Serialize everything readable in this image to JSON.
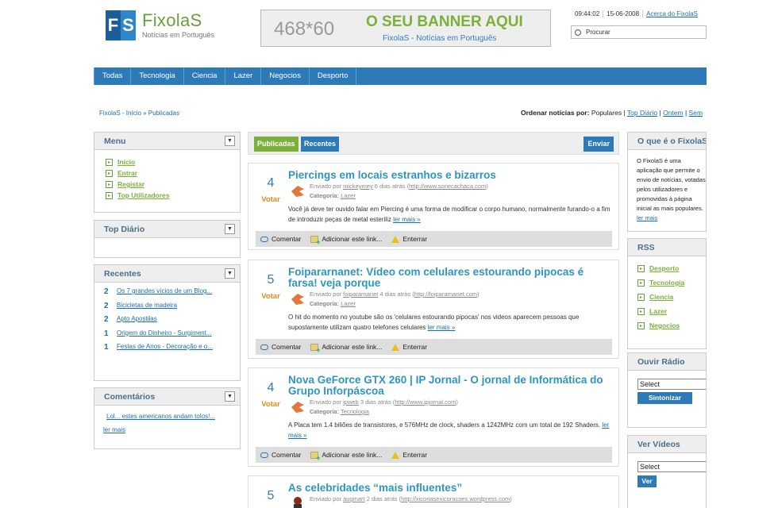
{
  "header": {
    "logo_mark": [
      "F",
      "S"
    ],
    "logo_name": "FixolaS",
    "logo_sub": "Notícias em Português",
    "banner_dim": "468*60",
    "banner_title": "O SEU BANNER AQUI",
    "banner_sub": "FixolaS - Notícias em Português",
    "time": "09:44:02",
    "date": "15-06-2008",
    "about_link": "Acerca do FixolaS",
    "search_placeholder": "Procurar"
  },
  "nav": [
    "Todas",
    "Tecnologia",
    "Ciencia",
    "Lazer",
    "Negocios",
    "Desporto"
  ],
  "breadcrumb": "FixolaS - Início » Publicadas",
  "order": {
    "label": "Ordenar notícias por:",
    "current": "Populares",
    "options": [
      "Top Diário",
      "Ontem",
      "Sem"
    ]
  },
  "left": {
    "menu": {
      "title": "Menu",
      "items": [
        "Início",
        "Entrar",
        "Registar",
        "Top Utilizadores"
      ]
    },
    "top_diario": {
      "title": "Top Diário"
    },
    "recentes": {
      "title": "Recentes",
      "items": [
        {
          "n": "2",
          "t": "Os 7 grandes vícios de um Blog..."
        },
        {
          "n": "2",
          "t": "Bicicletas de madeira"
        },
        {
          "n": "2",
          "t": "Apto Apostilas"
        },
        {
          "n": "1",
          "t": "Origem do Dinheiro - Surgiment..."
        },
        {
          "n": "1",
          "t": "Festas de Anos - Decoração e o..."
        }
      ]
    },
    "comentarios": {
      "title": "Comentários",
      "item": "Lol... estes americanos andam tolos!...",
      "more": "ler mais"
    }
  },
  "center": {
    "tabs": {
      "pub": "Publicadas",
      "rec": "Recentes",
      "send": "Enviar"
    },
    "vote_label": "Votar",
    "actions": [
      "Comentar",
      "Adicionar este link...",
      "Enterrar"
    ],
    "posts": [
      {
        "count": "4",
        "title": "Piercings em locais estranhos e bizarros",
        "meta1": "Enviado por",
        "user": "mickeymey",
        "ago": "6 dias atrás",
        "url": "http://www.sonecachaca.com",
        "cat_label": "Categoria:",
        "cat": "Lazer",
        "desc": "Você já deve ter ouvido falar em Piercing é uma forma de modificar o corpo humano, normalmente furando-o a fim de introduzir peças de metal esteriliz",
        "more": "ler mais »"
      },
      {
        "count": "5",
        "title": "Foipararnanet: Vídeo com celulares estourando pipocas é farsa! veja porque",
        "meta1": "Enviado por",
        "user": "foipararnanet",
        "ago": "4 dias atrás",
        "url": "http://foipararnanet.com",
        "cat_label": "Categoria:",
        "cat": "Lazer",
        "desc": "O hit do momento no youtube são os 'celulares estourando pipocas' nos videos aparecem pessoas que supostamente utilizam quatro telefones celulares",
        "more": "ler mais »"
      },
      {
        "count": "4",
        "title": "Nova GeForce GTX 260 | IP Jornal - O jornal de Informática do Grupo Inforpáscoa",
        "meta1": "Enviado por",
        "user": "ipweb",
        "ago": "3 dias atrás",
        "url": "http://www.ipjornal.com",
        "cat_label": "Categoria:",
        "cat": "Tecnologia",
        "desc": "A Placa tem 1.4 biliões de transistores, e 576MHz de clock, shaders a 1242MHz com um total de 192 Shaders.",
        "more": "ler mais »"
      },
      {
        "count": "5",
        "title": "As celebridades “mais influentes”",
        "meta1": "Enviado por",
        "user": "augmart",
        "ago": "2 dias atrás",
        "url": "http://xicoriasexicoracoes.wordpress.com"
      }
    ]
  },
  "right": {
    "about": {
      "title": "O que é o FixolaS",
      "text": "O FixolaS é uma aplicação que permite o envio de notícias, votadas pelos utilizadores e promovidas à página inicial as mais populares.",
      "more": "ler mais"
    },
    "rss": {
      "title": "RSS",
      "items": [
        "Desporto",
        "Tecnologia",
        "Ciencia",
        "Lazer",
        "Negocios"
      ]
    },
    "radio": {
      "title": "Ouvir Rádio",
      "select": "Select",
      "button": "Sintonizar"
    },
    "videos": {
      "title": "Ver Vídeos",
      "select": "Select",
      "button": "Ver"
    }
  }
}
